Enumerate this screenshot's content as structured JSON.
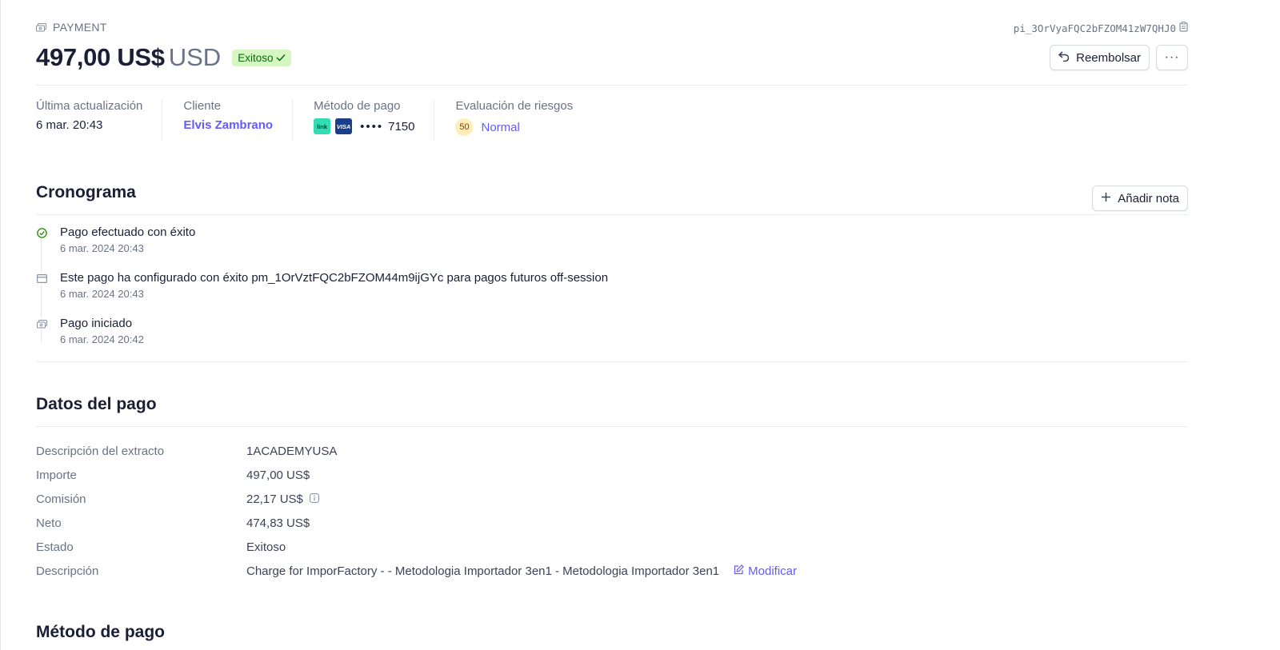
{
  "header": {
    "eyebrow": "PAYMENT",
    "payment_id": "pi_3OrVyaFQC2bFZOM41zW7QHJ0",
    "amount": "497,00 US$",
    "currency": "USD",
    "status_badge": "Exitoso",
    "refund_label": "Reembolsar",
    "more_label": "···"
  },
  "summary": {
    "updated_label": "Última actualización",
    "updated_value": "6 mar. 20:43",
    "customer_label": "Cliente",
    "customer_value": "Elvis Zambrano",
    "method_label": "Método de pago",
    "card_brand_link": "link",
    "card_brand_visa": "VISA",
    "card_dots": "••••",
    "card_last4": "7150",
    "risk_label": "Evaluación de riesgos",
    "risk_score": "50",
    "risk_value": "Normal"
  },
  "timeline": {
    "title": "Cronograma",
    "add_note_label": "Añadir nota",
    "events": [
      {
        "title": "Pago efectuado con éxito",
        "date": "6 mar. 2024 20:43",
        "icon": "check-circle-icon"
      },
      {
        "title": "Este pago ha configurado con éxito pm_1OrVztFQC2bFZOM44m9ijGYc para pagos futuros off-session",
        "date": "6 mar. 2024 20:43",
        "icon": "card-icon"
      },
      {
        "title": "Pago iniciado",
        "date": "6 mar. 2024 20:42",
        "icon": "payment-icon"
      }
    ]
  },
  "details": {
    "title": "Datos del pago",
    "rows": [
      {
        "label": "Descripción del extracto",
        "value": "1ACADEMYUSA"
      },
      {
        "label": "Importe",
        "value": "497,00 US$"
      },
      {
        "label": "Comisión",
        "value": "22,17 US$"
      },
      {
        "label": "Neto",
        "value": "474,83 US$"
      },
      {
        "label": "Estado",
        "value": "Exitoso"
      },
      {
        "label": "Descripción",
        "value": "Charge for ImporFactory - - Metodologia Importador 3en1 - Metodologia Importador 3en1"
      }
    ],
    "edit_label": "Modificar"
  },
  "next_section": {
    "title": "Método de pago"
  },
  "colors": {
    "accent": "#635bff",
    "success_bg": "#d7f7c2",
    "success_text": "#05690d",
    "muted_text": "#697386"
  }
}
